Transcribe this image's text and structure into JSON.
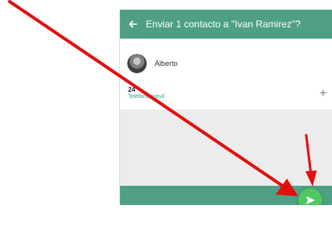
{
  "header": {
    "title": "Enviar 1 contacto a \"Ivan Ramirez\"?",
    "back_icon": "arrow-left-icon"
  },
  "contact": {
    "name": "Alberto",
    "avatar": "contact-photo"
  },
  "phone": {
    "value": "24",
    "label": "Teléfono móvil",
    "add_icon": "plus-icon"
  },
  "send_button": {
    "icon": "send-icon"
  },
  "colors": {
    "header": "#4fa082",
    "body": "#ececec",
    "fab": "#4fc861",
    "annotation": "#e01010"
  }
}
